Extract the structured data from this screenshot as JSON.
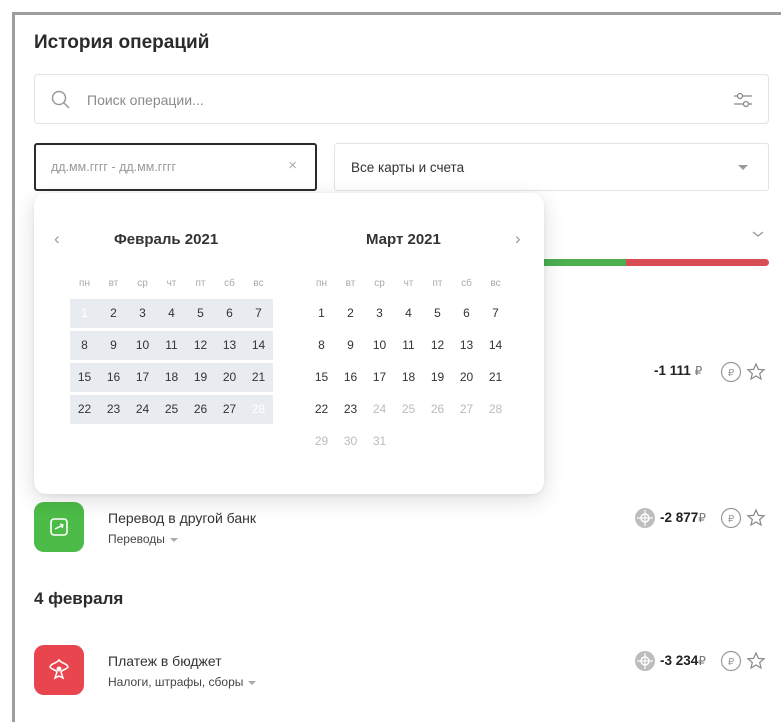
{
  "title": "История операций",
  "search": {
    "placeholder": "Поиск операции..."
  },
  "date_filter": {
    "placeholder": "дд.мм.гггг - дд.мм.гггг",
    "clear": "×"
  },
  "cards_filter": {
    "value": "Все карты и счета"
  },
  "calendar": {
    "prev": "‹",
    "next": "›",
    "left_month": "Февраль 2021",
    "right_month": "Март 2021",
    "weekdays": [
      "пн",
      "вт",
      "ср",
      "чт",
      "пт",
      "сб",
      "вс"
    ],
    "feb_rows": [
      [
        "1",
        "2",
        "3",
        "4",
        "5",
        "6",
        "7"
      ],
      [
        "8",
        "9",
        "10",
        "11",
        "12",
        "13",
        "14"
      ],
      [
        "15",
        "16",
        "17",
        "18",
        "19",
        "20",
        "21"
      ],
      [
        "22",
        "23",
        "24",
        "25",
        "26",
        "27",
        "28"
      ]
    ],
    "mar_rows": [
      [
        "1",
        "2",
        "3",
        "4",
        "5",
        "6",
        "7"
      ],
      [
        "8",
        "9",
        "10",
        "11",
        "12",
        "13",
        "14"
      ],
      [
        "15",
        "16",
        "17",
        "18",
        "19",
        "20",
        "21"
      ],
      [
        "22",
        "23",
        "24",
        "25",
        "26",
        "27",
        "28"
      ],
      [
        "29",
        "30",
        "31"
      ]
    ],
    "selected_start": "1",
    "selected_end": "28",
    "march_enabled_through": 23
  },
  "transactions": [
    {
      "amount": "-1 111",
      "currency": "₽"
    },
    {
      "title": "Перевод в другой банк",
      "category": "Переводы",
      "amount": "-2 877",
      "currency": "₽",
      "color": "#4cbb47"
    },
    {
      "title": "Платеж в бюджет",
      "category": "Налоги, штрафы, сборы",
      "amount": "-3 234",
      "currency": "₽",
      "color": "#e8454f"
    }
  ],
  "section_date": "4 февраля",
  "colors": {
    "accent": "#4a86e8",
    "income_bar": "#4caf50",
    "expense_bar": "#d84c53"
  }
}
